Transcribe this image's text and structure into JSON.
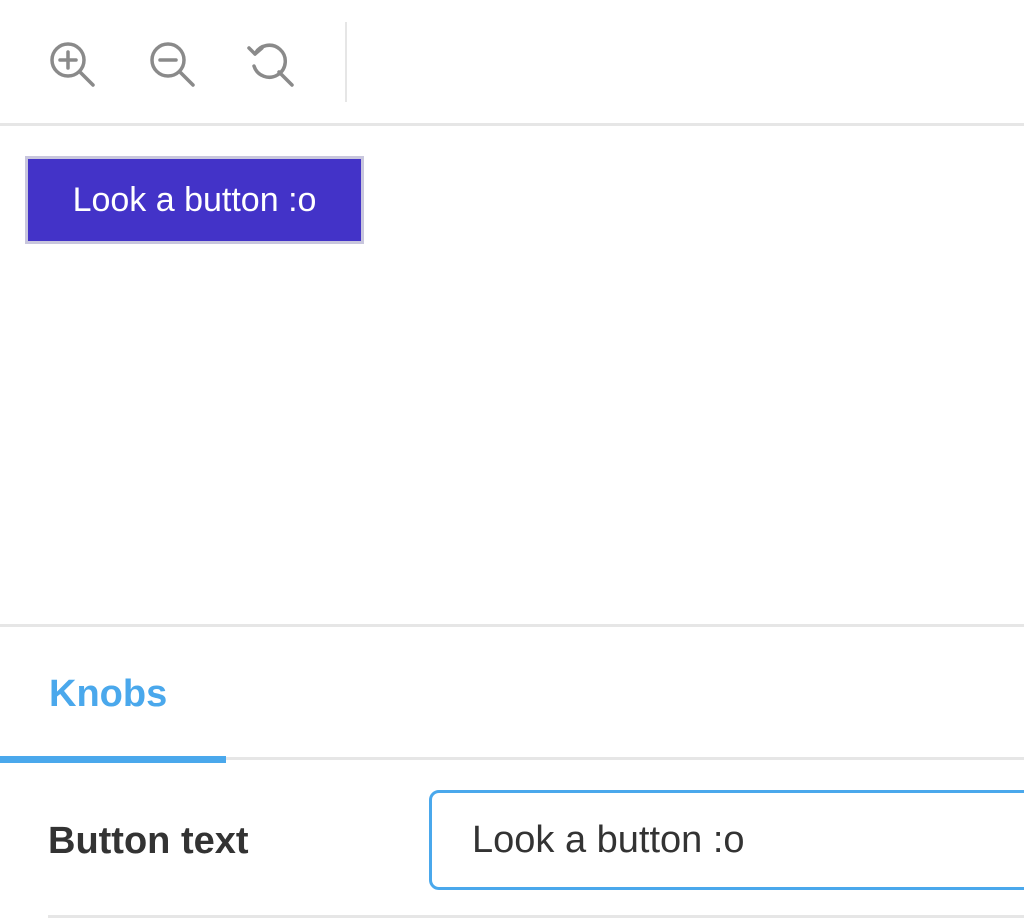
{
  "toolbar": {
    "zoom_in_icon": "zoom-in-icon",
    "zoom_out_icon": "zoom-out-icon",
    "zoom_reset_icon": "zoom-reset-icon",
    "icon_color": "#8a8a8a"
  },
  "preview": {
    "button_label": "Look a button :o",
    "button_color": "#4333c8"
  },
  "addons": {
    "tabs": [
      {
        "label": "Knobs",
        "active": true
      }
    ],
    "accent_color": "#4aa8ec",
    "knobs": [
      {
        "label": "Button text",
        "value": "Look a button :o"
      }
    ]
  }
}
